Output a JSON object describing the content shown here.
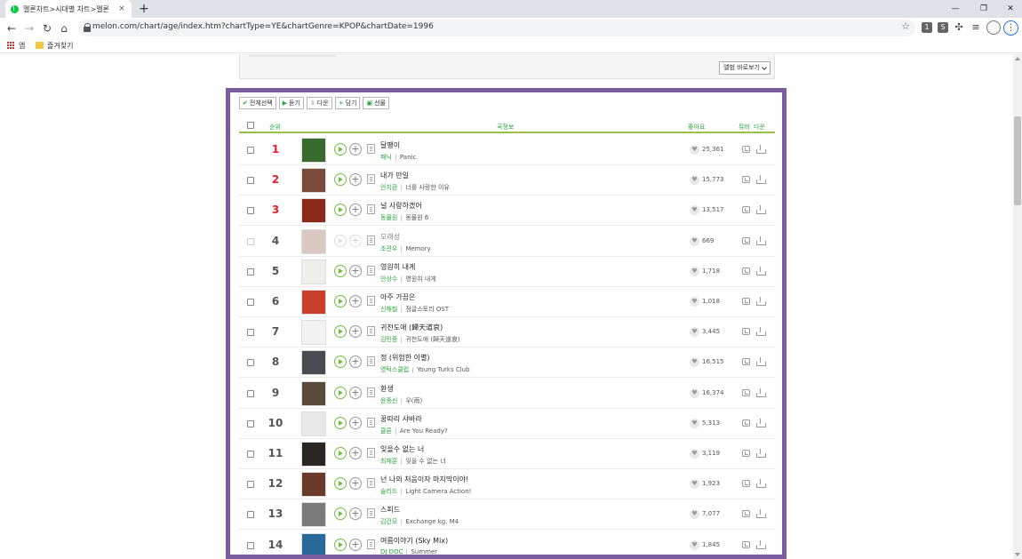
{
  "browser": {
    "tab_title": "멜론차트>시대별 차트>멜론",
    "tab_close": "×",
    "new_tab": "+",
    "url": "melon.com/chart/age/index.htm?chartType=YE&chartGenre=KPOP&chartDate=1996",
    "bookmarks": {
      "apps_label": "앱",
      "favorites_label": "즐겨찾기"
    }
  },
  "filter": {
    "shortcut_label": "앨범 바로보기"
  },
  "actions": [
    {
      "icon": "✔",
      "label": "전체선택"
    },
    {
      "icon": "▶",
      "label": "듣기"
    },
    {
      "icon": "⇩",
      "label": "다운"
    },
    {
      "icon": "+",
      "label": "담기"
    },
    {
      "icon": "▣",
      "label": "선물"
    }
  ],
  "columns": {
    "rank": "순위",
    "song_info": "곡정보",
    "likes": "좋아요",
    "mv": "뮤비",
    "download": "다운"
  },
  "rows": [
    {
      "rank": "1",
      "title": "달팽이",
      "artist": "패닉",
      "album": "Panic",
      "likes": "25,361",
      "cover": "#3a6b2e",
      "disabled": false
    },
    {
      "rank": "2",
      "title": "내가 만일",
      "artist": "안치환",
      "album": "너를 사랑한 이유",
      "likes": "15,773",
      "cover": "#7a4a3a",
      "disabled": false
    },
    {
      "rank": "3",
      "title": "널 사랑하겠어",
      "artist": "동물원",
      "album": "동물원 6",
      "likes": "13,517",
      "cover": "#8a2a1a",
      "disabled": false
    },
    {
      "rank": "4",
      "title": "모래성",
      "artist": "조관우",
      "album": "Memory",
      "likes": "669",
      "cover": "#d8c8c0",
      "disabled": true
    },
    {
      "rank": "5",
      "title": "영원히 내게",
      "artist": "안상수",
      "album": "영원히 내게",
      "likes": "1,718",
      "cover": "#eeeeea",
      "disabled": false
    },
    {
      "rank": "6",
      "title": "아주 가끔은",
      "artist": "신해철",
      "album": "정글스토리 OST",
      "likes": "1,018",
      "cover": "#c8402a",
      "disabled": false
    },
    {
      "rank": "7",
      "title": "귀천도애 (歸天道哀)",
      "artist": "김민종",
      "album": "귀천도애 (歸天道哀)",
      "likes": "3,445",
      "cover": "#f2f2f2",
      "disabled": false
    },
    {
      "rank": "8",
      "title": "정 (위험한 이별)",
      "artist": "영턱스클럽",
      "album": "Young Turks Club",
      "likes": "16,515",
      "cover": "#4a4a52",
      "disabled": false
    },
    {
      "rank": "9",
      "title": "환생",
      "artist": "윤종신",
      "album": "우(雨)",
      "likes": "16,374",
      "cover": "#5a4a3a",
      "disabled": false
    },
    {
      "rank": "10",
      "title": "꿍따리 샤바라",
      "artist": "클론",
      "album": "Are You Ready?",
      "likes": "5,313",
      "cover": "#e8e8e8",
      "disabled": false
    },
    {
      "rank": "11",
      "title": "잊을수 없는 너",
      "artist": "최재훈",
      "album": "잊을 수 없는 너",
      "likes": "3,119",
      "cover": "#2a2622",
      "disabled": false
    },
    {
      "rank": "12",
      "title": "넌 나의 처음이자 마지막이야!",
      "artist": "슬리드",
      "album": "Light Camera Action!",
      "likes": "1,923",
      "cover": "#6a3a2a",
      "disabled": false
    },
    {
      "rank": "13",
      "title": "스피드",
      "artist": "김건모",
      "album": "Exchange kg. M4",
      "likes": "7,077",
      "cover": "#7a7a7a",
      "disabled": false
    },
    {
      "rank": "14",
      "title": "여름이야기 (Sky Mix)",
      "artist": "DJ DOC",
      "album": "Summer",
      "likes": "1,845",
      "cover": "#2a6a9a",
      "disabled": false
    }
  ],
  "accent_color": "#2aa63b",
  "frame_color": "#7b5ca1"
}
